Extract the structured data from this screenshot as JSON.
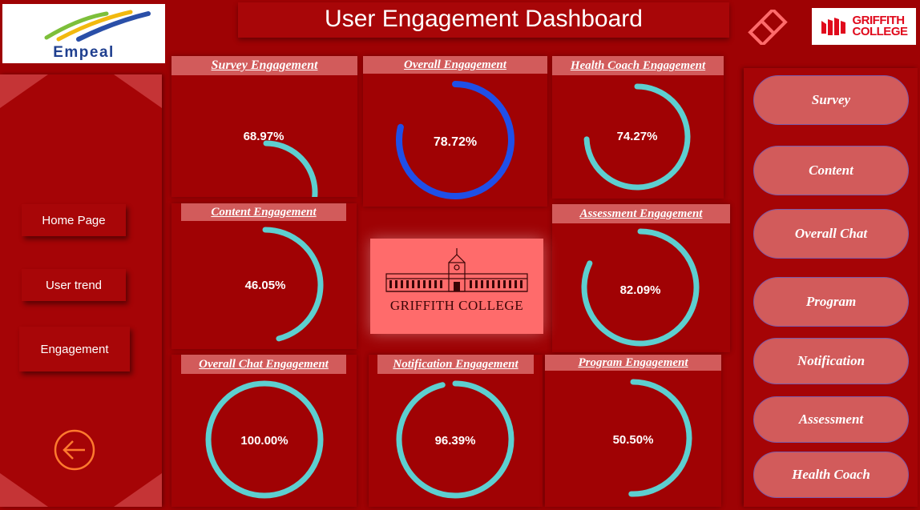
{
  "header": {
    "title": "User Engagement Dashboard",
    "left_logo_text": "Empeal",
    "right_logo_text_line1": "GRIFFITH",
    "right_logo_text_line2": "COLLEGE"
  },
  "left_nav": {
    "items": [
      {
        "label": "Home Page"
      },
      {
        "label": "User trend"
      },
      {
        "label": "Engagement"
      }
    ],
    "back_icon": "arrow-left-circle-icon"
  },
  "cards": [
    {
      "title": "Survey Engagement",
      "value_label": "68.97%",
      "value": 68.97
    },
    {
      "title": "Overall Engagement",
      "value_label": "78.72%",
      "value": 78.72
    },
    {
      "title": "Health Coach Engagement",
      "value_label": "74.27%",
      "value": 74.27
    },
    {
      "title": "Content Engagement",
      "value_label": "46.05%",
      "value": 46.05
    },
    {
      "title": "Assessment Engagement",
      "value_label": "82.09%",
      "value": 82.09
    },
    {
      "title": "Overall Chat Engagement",
      "value_label": "100.00%",
      "value": 100.0
    },
    {
      "title": "Notification Engagement",
      "value_label": "96.39%",
      "value": 96.39
    },
    {
      "title": "Program Engagement",
      "value_label": "50.50%",
      "value": 50.5
    }
  ],
  "center_image": {
    "caption": "GRIFFITH COLLEGE"
  },
  "right_nav": {
    "items": [
      {
        "label": "Survey"
      },
      {
        "label": "Content"
      },
      {
        "label": "Overall Chat"
      },
      {
        "label": "Program"
      },
      {
        "label": "Notification"
      },
      {
        "label": "Assessment"
      },
      {
        "label": "Health Coach"
      }
    ]
  },
  "colors": {
    "background": "#9e0204",
    "panel": "#a80608",
    "header_pink": "#d25b5b",
    "gauge_teal": "#5dcfd0",
    "gauge_blue": "#1f4fe8",
    "center_pink": "#ff6b6b",
    "back_orange": "#ff7a2e"
  }
}
